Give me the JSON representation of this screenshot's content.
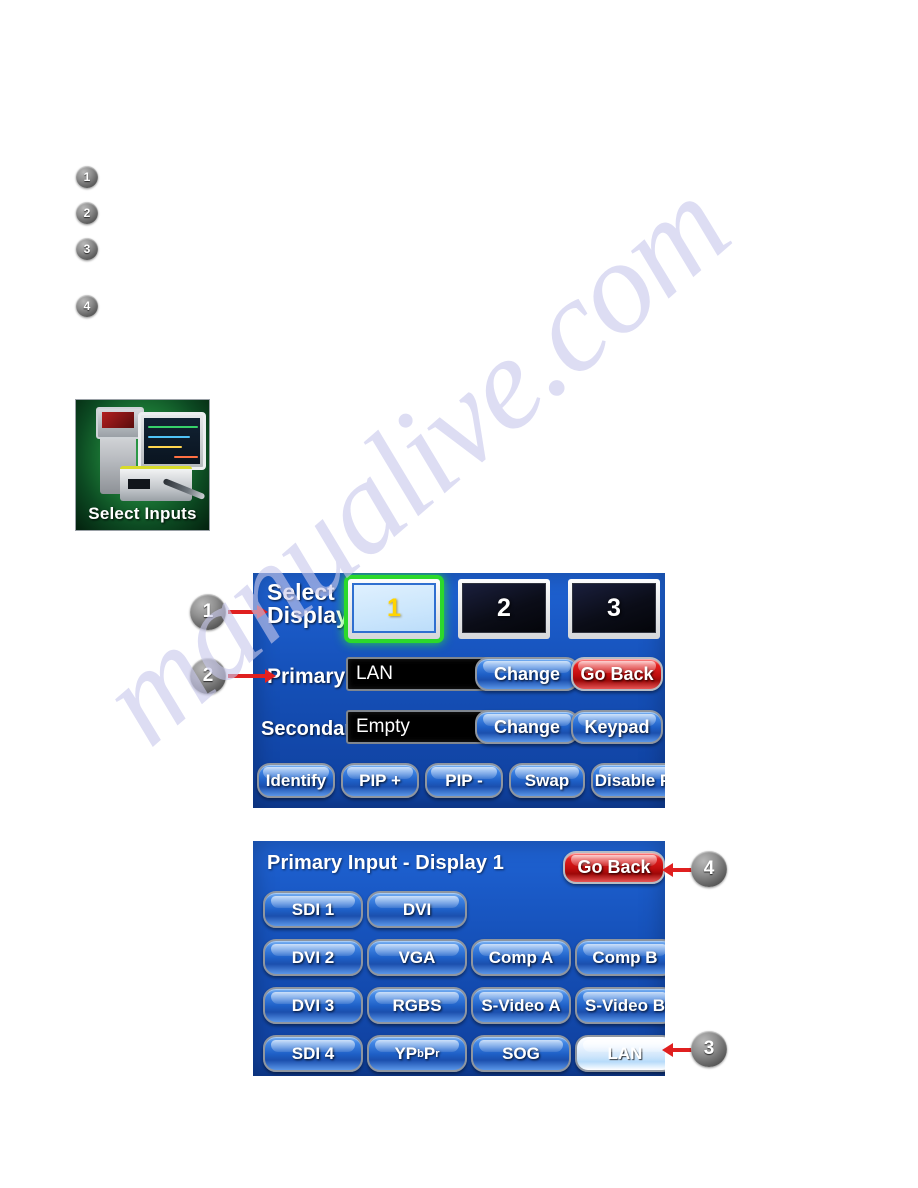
{
  "watermark": {
    "text": "manualive.com"
  },
  "callouts": [
    {
      "number": "1"
    },
    {
      "number": "2"
    },
    {
      "number": "3"
    },
    {
      "number": "4"
    }
  ],
  "margin_markers": [
    {
      "number": "1"
    },
    {
      "number": "2"
    },
    {
      "number": "3"
    },
    {
      "number": "4"
    }
  ],
  "select_inputs_thumb": {
    "label": "Select Inputs"
  },
  "panel_select_display": {
    "select_display_label": "Select\nDisplay",
    "select_display_label_line1": "Select",
    "select_display_label_line2": "Display",
    "displays": [
      {
        "label": "1",
        "selected": true
      },
      {
        "label": "2",
        "selected": false
      },
      {
        "label": "3",
        "selected": false
      }
    ],
    "primary_label": "Primary",
    "primary_value": "LAN",
    "secondary_label": "Secondary",
    "secondary_value": "Empty",
    "change_primary_label": "Change",
    "change_secondary_label": "Change",
    "go_back_label": "Go Back",
    "keypad_label": "Keypad",
    "bottom_buttons": [
      {
        "label": "Identify"
      },
      {
        "label": "PIP +"
      },
      {
        "label": "PIP -"
      },
      {
        "label": "Swap"
      },
      {
        "label": "Disable PIP"
      }
    ]
  },
  "panel_primary_input": {
    "title": "Primary Input - Display 1",
    "go_back_label": "Go Back",
    "inputs": [
      {
        "label": "SDI 1",
        "selected": false
      },
      {
        "label": "DVI",
        "selected": false
      },
      {
        "label": "",
        "selected": false
      },
      {
        "label": "",
        "selected": false
      },
      {
        "label": "DVI 2",
        "selected": false
      },
      {
        "label": "VGA",
        "selected": false
      },
      {
        "label": "Comp A",
        "selected": false
      },
      {
        "label": "Comp B",
        "selected": false
      },
      {
        "label": "DVI 3",
        "selected": false
      },
      {
        "label": "RGBS",
        "selected": false
      },
      {
        "label": "S-Video A",
        "selected": false
      },
      {
        "label": "S-Video B",
        "selected": false
      },
      {
        "label": "SDI 4",
        "selected": false
      },
      {
        "label": "YPbPr",
        "selected": false
      },
      {
        "label": "SOG",
        "selected": false
      },
      {
        "label": "LAN",
        "selected": true
      }
    ],
    "ypbpr": {
      "main": "YP",
      "sub1": "b",
      "main2": "P",
      "sub2": "r"
    }
  },
  "colors": {
    "panel_blue": "#1550b8",
    "button_blue": "#1e5fc6",
    "accent_red": "#e31f1f",
    "selected_green": "#2bd92b",
    "arrow_red": "#e02020",
    "watermark": "#c9c9ec"
  }
}
